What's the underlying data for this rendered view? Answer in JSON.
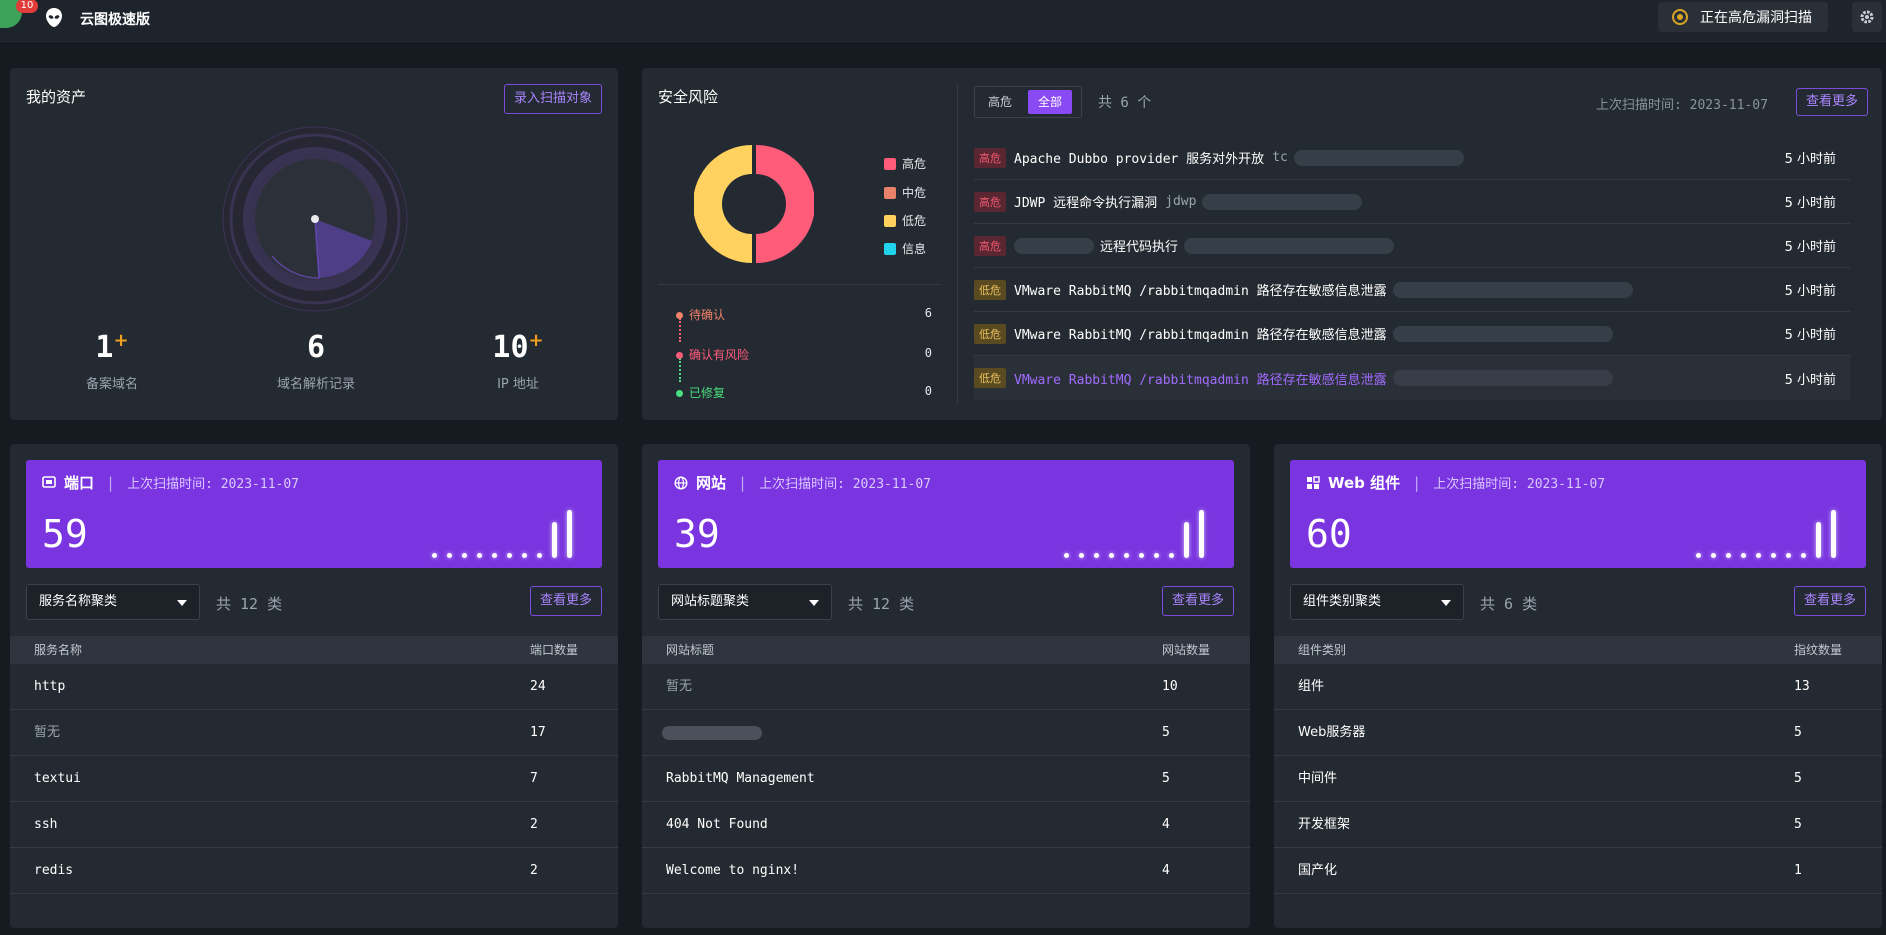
{
  "header": {
    "app_title": "云图极速版",
    "notification_count": "10",
    "scan_status": "正在高危漏洞扫描",
    "scan_icon": "scan-status-icon",
    "settings_icon": "gear-icon"
  },
  "assets": {
    "title": "我的资产",
    "add_button": "录入扫描对象",
    "stats": [
      {
        "value": "1",
        "plus": "+",
        "label": "备案域名"
      },
      {
        "value": "6",
        "plus": "",
        "label": "域名解析记录"
      },
      {
        "value": "10",
        "plus": "+",
        "label": "IP 地址"
      }
    ]
  },
  "security": {
    "title": "安全风险",
    "legend": [
      {
        "label": "高危",
        "color": "#ff5c7a"
      },
      {
        "label": "中危",
        "color": "#e8826a"
      },
      {
        "label": "低危",
        "color": "#ffd25f"
      },
      {
        "label": "信息",
        "color": "#22d3ee"
      }
    ],
    "donut": {
      "high": 3,
      "low": 3
    },
    "timeline": [
      {
        "label": "待确认",
        "value": "6",
        "color": "#f0826a"
      },
      {
        "label": "确认有风险",
        "value": "0",
        "color": "#ff5c7a"
      },
      {
        "label": "已修复",
        "value": "0",
        "color": "#4ade80"
      }
    ],
    "tabs": [
      "高危",
      "全部"
    ],
    "total": "共 6 个",
    "last_scan": "上次扫描时间: 2023-11-07",
    "more_button": "查看更多",
    "rows": [
      {
        "tag": "高危",
        "level": "high",
        "title": "Apache Dubbo provider 服务对外开放",
        "suffix": "tc",
        "time": "5 小时前"
      },
      {
        "tag": "高危",
        "level": "high",
        "title": "JDWP 远程命令执行漏洞",
        "suffix": "jdwp",
        "time": "5 小时前"
      },
      {
        "tag": "高危",
        "level": "high",
        "title": "远程代码执行",
        "suffix": "",
        "time": "5 小时前"
      },
      {
        "tag": "低危",
        "level": "low",
        "title": "VMware RabbitMQ /rabbitmqadmin 路径存在敏感信息泄露",
        "suffix": "",
        "time": "5 小时前"
      },
      {
        "tag": "低危",
        "level": "low",
        "title": "VMware RabbitMQ /rabbitmqadmin 路径存在敏感信息泄露",
        "suffix": "",
        "time": "5 小时前"
      },
      {
        "tag": "低危",
        "level": "low",
        "title": "VMware RabbitMQ /rabbitmqadmin 路径存在敏感信息泄露",
        "suffix": "",
        "time": "5 小时前"
      }
    ]
  },
  "cards": [
    {
      "title": "端口",
      "icon": "port-icon",
      "last_scan": "上次扫描时间: 2023-11-07",
      "count": "59",
      "select": "服务名称聚类",
      "total": "共 12 类",
      "more_button": "查看更多",
      "col1": "服务名称",
      "col2": "端口数量",
      "rows": [
        {
          "name": "http",
          "value": "24",
          "muted": false
        },
        {
          "name": "暂无",
          "value": "17",
          "muted": true
        },
        {
          "name": "textui",
          "value": "7",
          "muted": false
        },
        {
          "name": "ssh",
          "value": "2",
          "muted": false
        },
        {
          "name": "redis",
          "value": "2",
          "muted": false
        }
      ]
    },
    {
      "title": "网站",
      "icon": "globe-icon",
      "last_scan": "上次扫描时间: 2023-11-07",
      "count": "39",
      "select": "网站标题聚类",
      "total": "共 12 类",
      "more_button": "查看更多",
      "col1": "网站标题",
      "col2": "网站数量",
      "rows": [
        {
          "name": "暂无",
          "value": "10",
          "muted": true
        },
        {
          "name": "",
          "value": "5",
          "muted": false
        },
        {
          "name": "RabbitMQ Management",
          "value": "5",
          "muted": false
        },
        {
          "name": "404 Not Found",
          "value": "4",
          "muted": false
        },
        {
          "name": "Welcome to nginx!",
          "value": "4",
          "muted": false
        }
      ]
    },
    {
      "title": "Web 组件",
      "icon": "grid-icon",
      "last_scan": "上次扫描时间: 2023-11-07",
      "count": "60",
      "select": "组件类别聚类",
      "total": "共 6 类",
      "more_button": "查看更多",
      "col1": "组件类别",
      "col2": "指纹数量",
      "rows": [
        {
          "name": "组件",
          "value": "13",
          "muted": false
        },
        {
          "name": "Web服务器",
          "value": "5",
          "muted": false
        },
        {
          "name": "中间件",
          "value": "5",
          "muted": false
        },
        {
          "name": "开发框架",
          "value": "5",
          "muted": false
        },
        {
          "name": "国产化",
          "value": "1",
          "muted": false
        }
      ]
    }
  ]
}
